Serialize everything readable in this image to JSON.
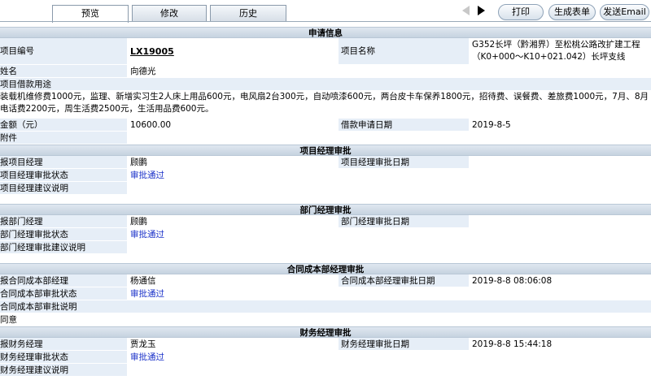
{
  "tabs": [
    "预览",
    "修改",
    "历史"
  ],
  "buttons": {
    "print": "打印",
    "generate": "生成表单",
    "email": "发送Email"
  },
  "apply": {
    "section": "申请信息",
    "project_no_label": "项目编号",
    "project_no": "LX19005",
    "project_name_label": "项目名称",
    "project_name": "G352长坪（黔湘界）至松桃公路改扩建工程（K0+000～K10+021.042）长坪支线",
    "name_label": "姓名",
    "name": "向德光",
    "purpose_label": "项目借款用途",
    "purpose": "装载机维修费1000元，监理、新增实习生2人床上用品600元，电风扇2台300元，自动喷漆600元，两台皮卡车保养1800元，招待费、误餐费、差旅费1000元，7月、8月电话费2200元，周生活费2500元，生活用品费600元。",
    "amount_label": "金额（元）",
    "amount": "10600.00",
    "date_label": "借款申请日期",
    "date": "2019-8-5",
    "attachment_label": "附件"
  },
  "pm": {
    "section": "项目经理审批",
    "manager_label": "报项目经理",
    "manager": "顾鹏",
    "date_label": "项目经理审批日期",
    "date": "",
    "status_label": "项目经理审批状态",
    "status": "审批通过",
    "note_label": "项目经理建议说明",
    "note": ""
  },
  "dept": {
    "section": "部门经理审批",
    "manager_label": "报部门经理",
    "manager": "顾鹏",
    "date_label": "部门经理审批日期",
    "date": "",
    "status_label": "部门经理审批状态",
    "status": "审批通过",
    "note_label": "部门经理审批建议说明",
    "note": ""
  },
  "contract": {
    "section": "合同成本部经理审批",
    "manager_label": "报合同成本部经理",
    "manager": "杨通信",
    "date_label": "合同成本部经理审批日期",
    "date": "2019-8-8 08:06:08",
    "status_label": "合同成本部审批状态",
    "status": "审批通过",
    "note_label": "合同成本部审批说明",
    "note": "同意"
  },
  "finance": {
    "section": "财务经理审批",
    "manager_label": "报财务经理",
    "manager": "贾龙玉",
    "date_label": "财务经理审批日期",
    "date": "2019-8-8 15:44:18",
    "status_label": "财务经理审批状态",
    "status": "审批通过",
    "note_label": "财务经理建议说明",
    "note": ""
  }
}
